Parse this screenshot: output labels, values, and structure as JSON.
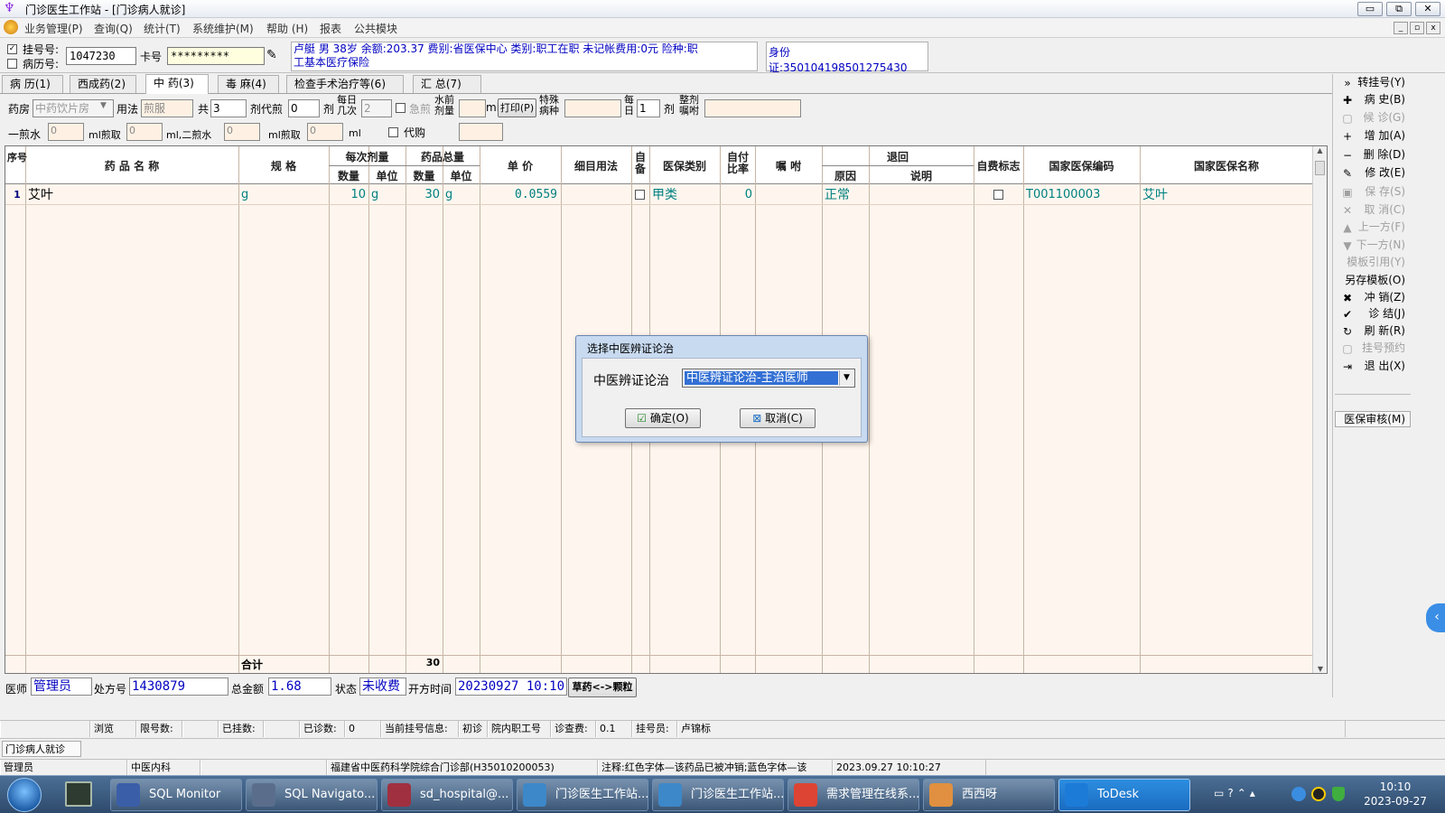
{
  "window": {
    "title": "门诊医生工作站 - [门诊病人就诊]",
    "controls": [
      "▭",
      "⧉",
      "✕"
    ]
  },
  "menu": [
    "业务管理(P)",
    "查询(Q)",
    "统计(T)",
    "系统维护(M)",
    "帮助 (H)",
    "报表",
    "公共模块"
  ],
  "info": {
    "reg_label": "挂号号:",
    "record_label": "病历号:",
    "reg_no": "1047230",
    "card_label": "卡号",
    "card_no": "*********",
    "patient_line1": "卢艇 男 38岁 余额:203.37 费别:省医保中心 类别:职工在职 未记帐费用:0元 险种:职",
    "patient_line2": "工基本医疗保险",
    "id_card": "身份证:350104198501275430"
  },
  "tabs": [
    "病 历(1)",
    "西成药(2)",
    "中 药(3)",
    "毒 麻(4)",
    "检查手术治疗等(6)",
    "汇 总(7)"
  ],
  "options": {
    "pharmacy_label": "药房",
    "pharmacy_value": "中药饮片房",
    "usage_label": "用法",
    "usage_value": "煎服",
    "total_label": "共",
    "total_value": "3",
    "dose_label": "剂代煎",
    "decoct_value": "0",
    "dose_unit": "剂",
    "per_day_label1": "每日",
    "per_day_label2": "几次",
    "per_day_value": "2",
    "urgent_label": "急煎",
    "water_label1": "水前",
    "water_label2": "剂量",
    "ml": "ml",
    "print_label": "打印(P)",
    "special_label1": "特殊",
    "special_label2": "病种",
    "daily_label1": "每",
    "daily_label2": "日",
    "daily_value": "1",
    "daily_unit": "剂",
    "whole_label1": "整剂",
    "whole_label2": "嘱咐",
    "first_water": "一煎水",
    "first_water_value": "0",
    "ml_take": "ml煎取",
    "take_value": "0",
    "ml_second": "ml,二煎水",
    "second_water_value": "0",
    "ml_take2": "ml煎取",
    "take2_value": "0",
    "ml_end": "ml",
    "proxy_label": "代购"
  },
  "grid": {
    "headers": {
      "seq": "序号",
      "name": "药 品 名 称",
      "spec": "规 格",
      "each_dose": "每次剂量",
      "qty": "数量",
      "unit": "单位",
      "total": "药品总量",
      "qty2": "数量",
      "unit2": "单位",
      "price": "单 价",
      "usage": "细目用法",
      "self": "自备",
      "insurance_type": "医保类别",
      "self_pay": "自付比率",
      "note": "嘱 咐",
      "return": "退回",
      "reason": "原因",
      "desc": "说明",
      "self_flag": "自费标志",
      "nat_code": "国家医保编码",
      "nat_name": "国家医保名称"
    },
    "rows": [
      {
        "seq": "1",
        "name": "艾叶",
        "spec": "g",
        "qty": "10",
        "unit": "g",
        "total_qty": "30",
        "total_unit": "g",
        "price": "0.0559",
        "insurance_type": "甲类",
        "self_pay": "0",
        "reason": "正常",
        "nat_code": "T001100003",
        "nat_name": "艾叶"
      }
    ],
    "total_label": "合计",
    "total_value": "30"
  },
  "right_buttons": [
    {
      "label": "转挂号(Y)",
      "icon": "»",
      "enabled": true
    },
    {
      "label": "病 史(B)",
      "icon": "✚",
      "enabled": true
    },
    {
      "label": "候 诊(G)",
      "icon": "▢",
      "enabled": false
    },
    {
      "label": "增 加(A)",
      "icon": "+",
      "enabled": true
    },
    {
      "label": "删 除(D)",
      "icon": "−",
      "enabled": true
    },
    {
      "label": "修 改(E)",
      "icon": "✎",
      "enabled": true
    },
    {
      "label": "保 存(S)",
      "icon": "▣",
      "enabled": false
    },
    {
      "label": "取 消(C)",
      "icon": "✕",
      "enabled": false
    },
    {
      "label": "上一方(F)",
      "icon": "▲",
      "enabled": false
    },
    {
      "label": "下一方(N)",
      "icon": "▼",
      "enabled": false
    },
    {
      "label": "模板引用(Y)",
      "icon": "",
      "enabled": false
    },
    {
      "label": "另存模板(O)",
      "icon": "",
      "enabled": true
    },
    {
      "label": "冲 销(Z)",
      "icon": "✖",
      "enabled": true
    },
    {
      "label": "诊 结(J)",
      "icon": "✔",
      "enabled": true
    },
    {
      "label": "刷 新(R)",
      "icon": "↻",
      "enabled": true
    },
    {
      "label": "挂号预约",
      "icon": "▢",
      "enabled": false
    },
    {
      "label": "退 出(X)",
      "icon": "⇥",
      "enabled": true
    },
    {
      "label": "医保审核(M)",
      "icon": "",
      "enabled": true
    }
  ],
  "bottom": {
    "doctor_label": "医师",
    "doctor": "管理员",
    "rx_label": "处方号",
    "rx_no": "1430879",
    "amount_label": "总金额",
    "amount": "1.68",
    "state_label": "状态",
    "state": "未收费",
    "time_label": "开方时间",
    "time": "20230927 10:10",
    "switch": "草药<->颗粒"
  },
  "status1": {
    "browse": "浏览",
    "limit": "限号数:",
    "registered": "已挂数:",
    "diagnosed_label": "已诊数:",
    "diagnosed": "0",
    "current": "当前挂号信息:",
    "first": "初诊",
    "staff": "院内职工号",
    "fee_label": "诊查费:",
    "fee": "0.1",
    "registrar_label": "挂号员:",
    "registrar": "卢锦标"
  },
  "status2": {
    "form": "门诊病人就诊"
  },
  "status3": {
    "user": "管理员",
    "dept": "中医内科",
    "hospital": "福建省中医药科学院综合门诊部(H35010200053)",
    "note": "注释:红色字体—该药品已被冲销;蓝色字体—该",
    "datetime": "2023.09.27 10:10:27"
  },
  "dialog": {
    "title": "选择中医辨证论治",
    "label": "中医辨证论治",
    "value": "中医辨证论治-主治医师",
    "ok": "确定(O)",
    "cancel": "取消(C)"
  },
  "taskbar": {
    "items": [
      {
        "label": "SQL Monitor",
        "color": "#3b5ea8"
      },
      {
        "label": "SQL Navigato...",
        "color": "#5a6e8c"
      },
      {
        "label": "sd_hospital@...",
        "color": "#a03040"
      },
      {
        "label": "门诊医生工作站...",
        "color": "#3d88c8"
      },
      {
        "label": "门诊医生工作站...",
        "color": "#3d88c8"
      },
      {
        "label": "需求管理在线系...",
        "color": "#dd4433"
      },
      {
        "label": "西西呀",
        "color": "#e09040"
      },
      {
        "label": "ToDesk",
        "color": "#1d7bd8"
      }
    ],
    "time": "10:10",
    "date": "2023-09-27"
  }
}
